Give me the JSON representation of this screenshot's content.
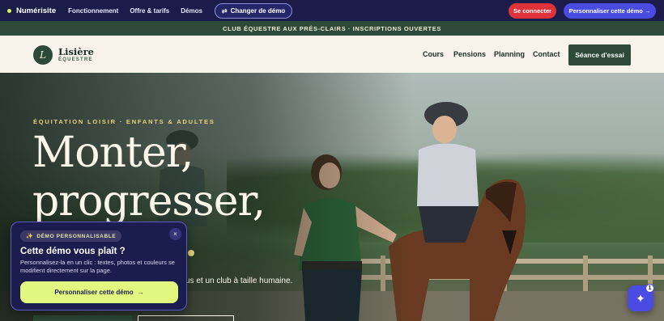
{
  "topbar": {
    "brand": "Numérisite",
    "nav": [
      "Fonctionnement",
      "Offre & tarifs",
      "Démos"
    ],
    "switch_demo": "Changer de démo",
    "login": "Se connecter",
    "customize": "Personnaliser cette démo →"
  },
  "announcement": "CLUB ÉQUESTRE AUX PRÉS-CLAIRS · INSCRIPTIONS OUVERTES",
  "header": {
    "logo_letter": "L",
    "logo_name": "Lisière",
    "logo_sub": "ÉQUESTRE",
    "menu": [
      "Cours",
      "Pensions",
      "Planning",
      "Contact"
    ],
    "cta": "Séance d'essai"
  },
  "hero": {
    "eyebrow": "ÉQUITATION LOISIR · ENFANTS & ADULTES",
    "title_line1": "Monter,",
    "title_line2": "progresser,",
    "lead_visible": "us et un club à taille humaine."
  },
  "popup": {
    "badge": "DÉMO PERSONNALISABLE",
    "close": "×",
    "title": "Cette démo vous plaît ?",
    "text": "Personnalisez-la en un clic : textes, photos et couleurs se modifient directement sur la page.",
    "cta": "Personnaliser cette démo",
    "cta_arrow": "→"
  },
  "fab": {
    "count": "1"
  },
  "colors": {
    "topbar_bg": "#1b1c4a",
    "brand_green": "#2c4a37",
    "accent_red": "#e0323a",
    "accent_indigo": "#4a4be0",
    "lime": "#e2f780",
    "gold": "#e8d27a"
  }
}
